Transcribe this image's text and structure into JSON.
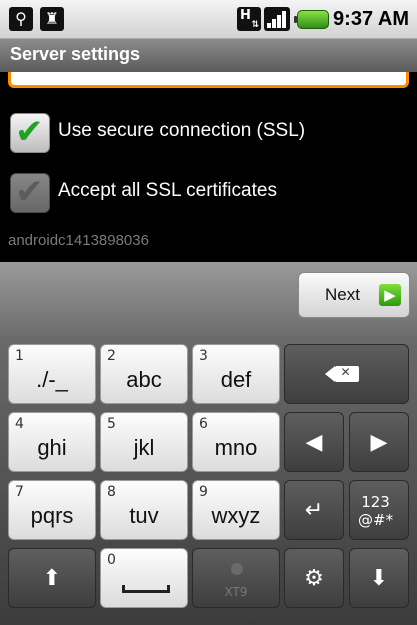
{
  "status_bar": {
    "time": "9:37 AM",
    "icons": [
      "usb-icon",
      "android-icon",
      "h-network-icon",
      "signal-icon",
      "battery-icon"
    ]
  },
  "title_bar": {
    "title": "Server settings"
  },
  "settings": {
    "ssl": {
      "label": "Use secure connection (SSL)",
      "checked": true
    },
    "accept_certs": {
      "label": "Accept all SSL certificates",
      "checked": true,
      "enabled": false
    },
    "account": "androidc1413898036"
  },
  "suggestion_bar": {
    "next_label": "Next"
  },
  "keyboard": {
    "row1": [
      {
        "num": "1",
        "label": "./-_"
      },
      {
        "num": "2",
        "label": "abc"
      },
      {
        "num": "3",
        "label": "def"
      }
    ],
    "row2": [
      {
        "num": "4",
        "label": "ghi"
      },
      {
        "num": "5",
        "label": "jkl"
      },
      {
        "num": "6",
        "label": "mno"
      }
    ],
    "row3": [
      {
        "num": "7",
        "label": "pqrs"
      },
      {
        "num": "8",
        "label": "tuv"
      },
      {
        "num": "9",
        "label": "wxyz"
      }
    ],
    "space_num": "0",
    "xt9_label": "XT9",
    "sym_label_top": "123",
    "sym_label_bottom": "@#*"
  },
  "colors": {
    "accent_green": "#21a321",
    "focus_orange": "#ff8a00"
  }
}
